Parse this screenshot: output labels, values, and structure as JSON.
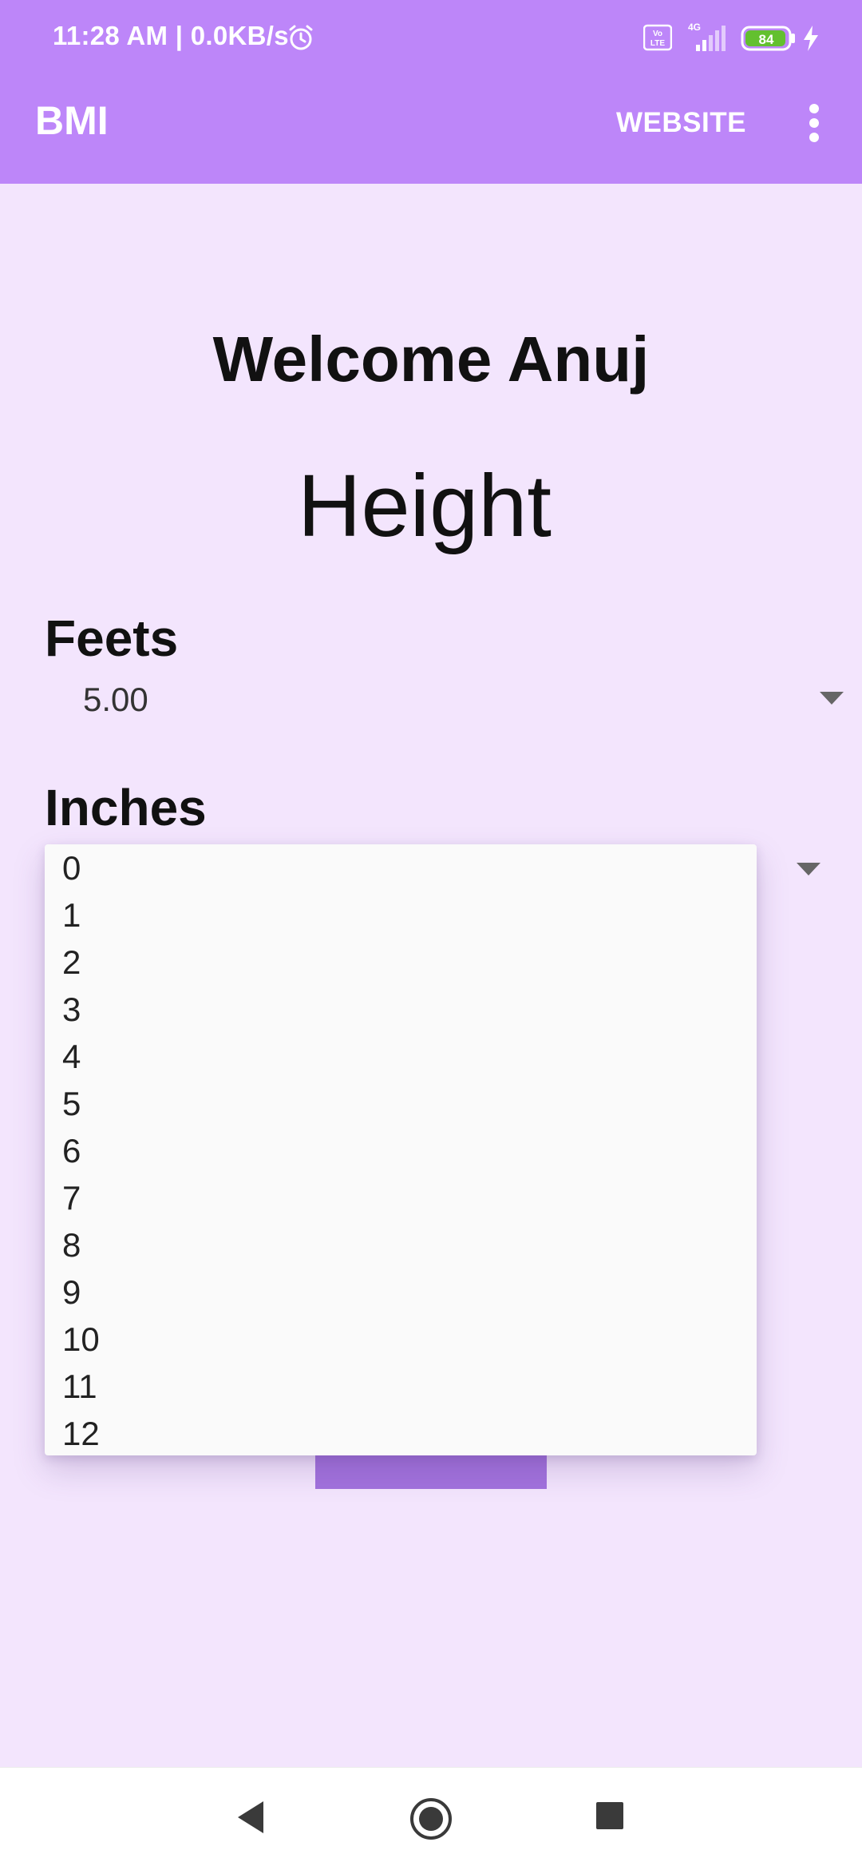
{
  "status_bar": {
    "time": "11:28 AM | 0.0KB/s",
    "network": "4G",
    "battery": "84",
    "icons": [
      "alarm-icon",
      "volte-icon",
      "signal-icon",
      "battery-icon",
      "charging-icon"
    ]
  },
  "app_bar": {
    "title": "BMI",
    "action_label": "WEBSITE",
    "overflow_icon": "more-vert-icon",
    "color": "#bd86f9"
  },
  "main": {
    "welcome": "Welcome Anuj",
    "section_title": "Height",
    "feets": {
      "label": "Feets",
      "value": "5.00"
    },
    "inches": {
      "label": "Inches"
    },
    "background": "#f3e5fd",
    "button_color": "#a272dd"
  },
  "dropdown": {
    "options": [
      "0",
      "1",
      "2",
      "3",
      "4",
      "5",
      "6",
      "7",
      "8",
      "9",
      "10",
      "11",
      "12"
    ]
  },
  "nav_bar": {
    "icons": [
      "back-icon",
      "home-icon",
      "recents-icon"
    ]
  }
}
